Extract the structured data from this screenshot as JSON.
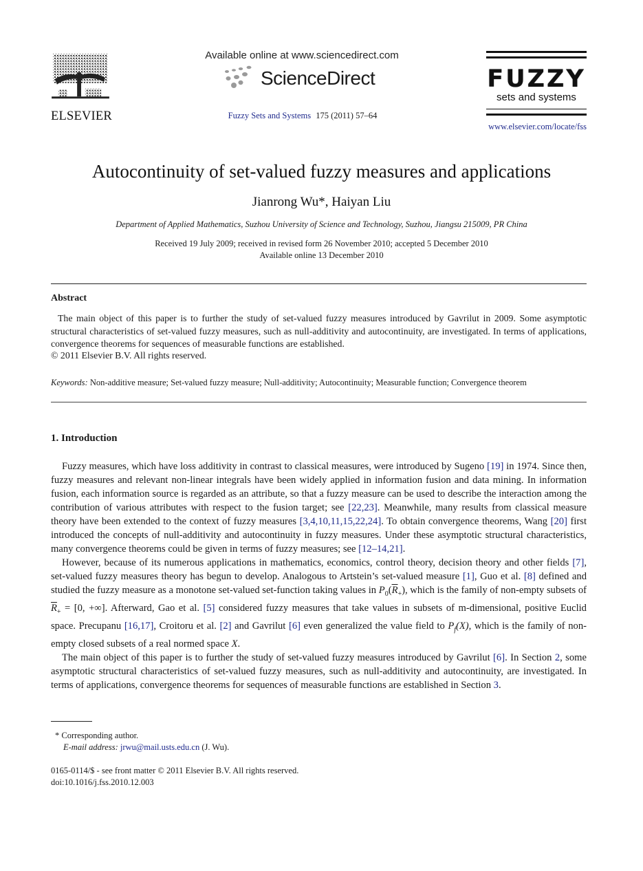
{
  "header": {
    "publisher_logo_text": "ELSEVIER",
    "available_online": "Available online at www.sciencedirect.com",
    "platform_logo_text": "ScienceDirect",
    "journal_name": "Fuzzy Sets and Systems",
    "journal_citation": "175 (2011) 57–64",
    "journal_logo_word": "FUZZY",
    "journal_logo_sub": "sets and systems",
    "journal_url": "www.elsevier.com/locate/fss"
  },
  "article": {
    "title": "Autocontinuity of set-valued fuzzy measures and applications",
    "authors": "Jianrong Wu*, Haiyan Liu",
    "affiliation": "Department of Applied Mathematics, Suzhou University of Science and Technology, Suzhou, Jiangsu 215009, PR China",
    "received": "Received 19 July 2009; received in revised form 26 November 2010; accepted 5 December 2010",
    "available": "Available online 13 December 2010"
  },
  "abstract": {
    "heading": "Abstract",
    "text": "The main object of this paper is to further the study of set-valued fuzzy measures introduced by Gavrilut in 2009. Some asymptotic structural characteristics of set-valued fuzzy measures, such as null-additivity and autocontinuity, are investigated. In terms of applications, convergence theorems for sequences of measurable functions are established.",
    "copyright": "© 2011 Elsevier B.V. All rights reserved.",
    "keywords_label": "Keywords:",
    "keywords": "Non-additive measure; Set-valued fuzzy measure; Null-additivity; Autocontinuity; Measurable function; Convergence theorem"
  },
  "intro": {
    "heading": "1.  Introduction",
    "p1": {
      "t1": "Fuzzy measures, which have loss additivity in contrast to classical measures, were introduced by Sugeno ",
      "r1": "[19]",
      "t2": " in 1974. Since then, fuzzy measures and relevant non-linear integrals have been widely applied in information fusion and data mining. In information fusion, each information source is regarded as an attribute, so that a fuzzy measure can be used to describe the interaction among the contribution of various attributes with respect to the fusion target; see ",
      "r2": "[22,23]",
      "t3": ". Meanwhile, many results from classical measure theory have been extended to the context of fuzzy measures ",
      "r3": "[3,4,10,11,15,22,24]",
      "t4": ". To obtain convergence theorems, Wang ",
      "r4": "[20]",
      "t5": " first introduced the concepts of null-additivity and autocontinuity in fuzzy measures. Under these asymptotic structural characteristics, many convergence theorems could be given in terms of fuzzy measures; see ",
      "r5": "[12–14,21]",
      "t6": "."
    },
    "p2": {
      "t1": "However, because of its numerous applications in mathematics, economics, control theory, decision theory and other fields ",
      "r1": "[7]",
      "t2": ", set-valued fuzzy measures theory has begun to develop. Analogous to Artstein’s set-valued measure ",
      "r2": "[1]",
      "t3": ", Guo et al. ",
      "r3": "[8]",
      "t4": " defined and studied the fuzzy measure as a monotone set-valued set-function taking values in ",
      "m1a": "P",
      "m1b": "0",
      "m1c": "(",
      "m1d": "R",
      "m1e": "+",
      "m1f": ")",
      "t5": ", which is the family of non-empty subsets of ",
      "m2a": "R",
      "m2b": "+",
      "m2c": " = [0, +∞]",
      "t6": ". Afterward, Gao et al. ",
      "r4": "[5]",
      "t7": " considered fuzzy measures that take values in subsets of m-dimensional, positive Euclid space. Precupanu ",
      "r5": "[16,17]",
      "t8": ", Croitoru et al. ",
      "r6": "[2]",
      "t9": " and Gavrilut ",
      "r7": "[6]",
      "t10": " even generalized the value field to ",
      "m3a": "P",
      "m3b": "f",
      "m3c": "(X)",
      "t11": ", which is the family of non-empty closed subsets of a real normed space ",
      "m4": "X",
      "t12": "."
    },
    "p3": {
      "t1": "The main object of this paper is to further the study of set-valued fuzzy measures introduced by Gavrilut ",
      "r1": "[6]",
      "t2": ". In Section ",
      "r2": "2",
      "t3": ", some asymptotic structural characteristics of set-valued fuzzy measures, such as null-additivity and autocontinuity, are investigated. In terms of applications, convergence theorems for sequences of measurable functions are established in Section ",
      "r3": "3",
      "t4": "."
    }
  },
  "footnotes": {
    "corresponding": "* Corresponding author.",
    "email_label": "E-mail address:",
    "email": "jrwu@mail.usts.edu.cn",
    "email_suffix": " (J. Wu).",
    "front_matter": "0165-0114/$ - see front matter © 2011 Elsevier B.V. All rights reserved.",
    "doi": "doi:10.1016/j.fss.2010.12.003"
  },
  "colors": {
    "link": "#1f2a8c",
    "text": "#1a1a1a"
  }
}
